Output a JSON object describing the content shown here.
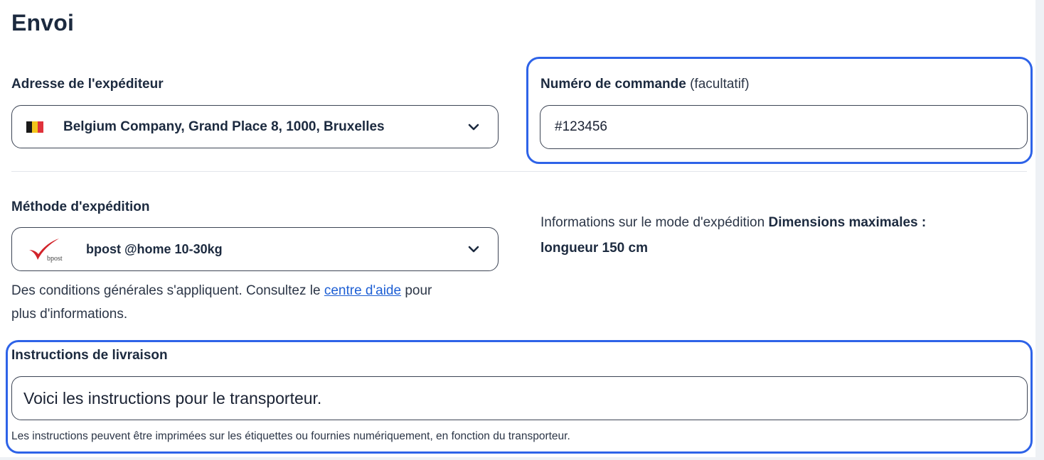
{
  "section": {
    "title": "Envoi"
  },
  "sender": {
    "label": "Adresse de l'expéditeur",
    "value": "Belgium Company, Grand Place 8, 1000, Bruxelles",
    "flag_colors": [
      "#1a1a1a",
      "#f2c51b",
      "#e0323b"
    ]
  },
  "order": {
    "label": "Numéro de commande",
    "optional": "(facultatif)",
    "value": "#123456"
  },
  "shipping": {
    "label": "Méthode d'expédition",
    "value": "bpost @home 10-30kg",
    "logo_text": "bpost",
    "terms_before": "Des conditions générales s'appliquent. Consultez le ",
    "terms_link": "centre d'aide",
    "terms_after": " pour",
    "terms_line2": "plus d'informations.",
    "info_text": "Informations sur le mode d'expédition ",
    "info_bold1": "Dimensions maximales :",
    "info_bold2": "longueur 150 cm"
  },
  "instructions": {
    "label": "Instructions de livraison",
    "value": "Voici les instructions pour le transporteur.",
    "note": "Les instructions peuvent être imprimées sur les étiquettes ou fournies numériquement, en fonction du transporteur."
  },
  "colors": {
    "highlight": "#2e63e8",
    "link": "#1e5fd4",
    "bpost_red": "#d2232a"
  }
}
